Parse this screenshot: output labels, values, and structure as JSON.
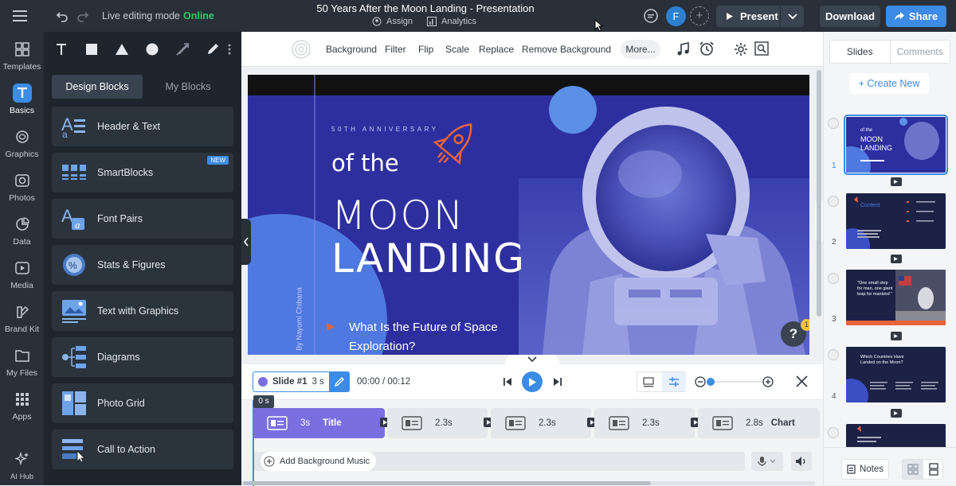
{
  "header": {
    "mode_label": "Live editing mode",
    "mode_status": "Online",
    "doc_title": "50 Years After the Moon Landing - Presentation",
    "assign_label": "Assign",
    "analytics_label": "Analytics",
    "avatar_initial": "F",
    "add_collaborator": "+",
    "present_label": "Present",
    "download_label": "Download",
    "share_label": "Share"
  },
  "rail": [
    {
      "label": "Templates",
      "icon": "templates-icon"
    },
    {
      "label": "Basics",
      "icon": "basics-icon",
      "active": true
    },
    {
      "label": "Graphics",
      "icon": "graphics-icon"
    },
    {
      "label": "Photos",
      "icon": "photos-icon"
    },
    {
      "label": "Data",
      "icon": "data-icon"
    },
    {
      "label": "Media",
      "icon": "media-icon"
    },
    {
      "label": "Brand Kit",
      "icon": "brand-kit-icon"
    },
    {
      "label": "My Files",
      "icon": "folder-icon"
    },
    {
      "label": "Apps",
      "icon": "apps-icon"
    },
    {
      "label": "AI Hub",
      "icon": "ai-hub-icon"
    }
  ],
  "panel": {
    "tabs": [
      "Design Blocks",
      "My Blocks"
    ],
    "new_badge": "NEW",
    "blocks": [
      {
        "label": "Header & Text"
      },
      {
        "label": "SmartBlocks"
      },
      {
        "label": "Font Pairs"
      },
      {
        "label": "Stats & Figures"
      },
      {
        "label": "Text with Graphics"
      },
      {
        "label": "Diagrams"
      },
      {
        "label": "Photo Grid"
      },
      {
        "label": "Call to Action"
      }
    ]
  },
  "toolbar": {
    "items": [
      "Background",
      "Filter",
      "Flip",
      "Scale",
      "Replace",
      "Remove Background"
    ],
    "more_label": "More..."
  },
  "slide": {
    "eyebrow": "50TH ANNIVERSARY",
    "line1": "of the",
    "line2": "MOON",
    "line3": "LANDING",
    "question1": "What Is the Future of Space",
    "question2": "Exploration?",
    "author": "By Nayomi Chibana",
    "help": "?",
    "help_badge": "1"
  },
  "timeline": {
    "slide_label": "Slide #1",
    "slide_duration": "3 s",
    "time": "00:00 / 00:12",
    "playhead": "0 s",
    "segments": [
      {
        "duration": "3s",
        "name": "Title"
      },
      {
        "duration": "2.3s",
        "name": ""
      },
      {
        "duration": "2.3s",
        "name": ""
      },
      {
        "duration": "2.3s",
        "name": ""
      },
      {
        "duration": "2.8s",
        "name": "Chart"
      }
    ],
    "add_music": "Add Background Music"
  },
  "right_panel": {
    "tabs": [
      "Slides",
      "Comments"
    ],
    "create_new": "+ Create New",
    "slide_numbers": [
      "1",
      "2",
      "3",
      "4"
    ],
    "notes_label": "Notes",
    "thumb1_lines": [
      "of the",
      "MOON",
      "LANDING"
    ],
    "thumb2_title": "Content",
    "thumb3_quote": "\"One small step for man, one giant leap for mankind \"",
    "thumb4_title": "Which Countries Have Landed on the Moon?"
  },
  "colors": {
    "accent": "#3c8be6",
    "online": "#37c66a",
    "slide_bg": "#2d2f9e",
    "segment_active": "#7a6fe0",
    "rocket": "#e8643a"
  }
}
